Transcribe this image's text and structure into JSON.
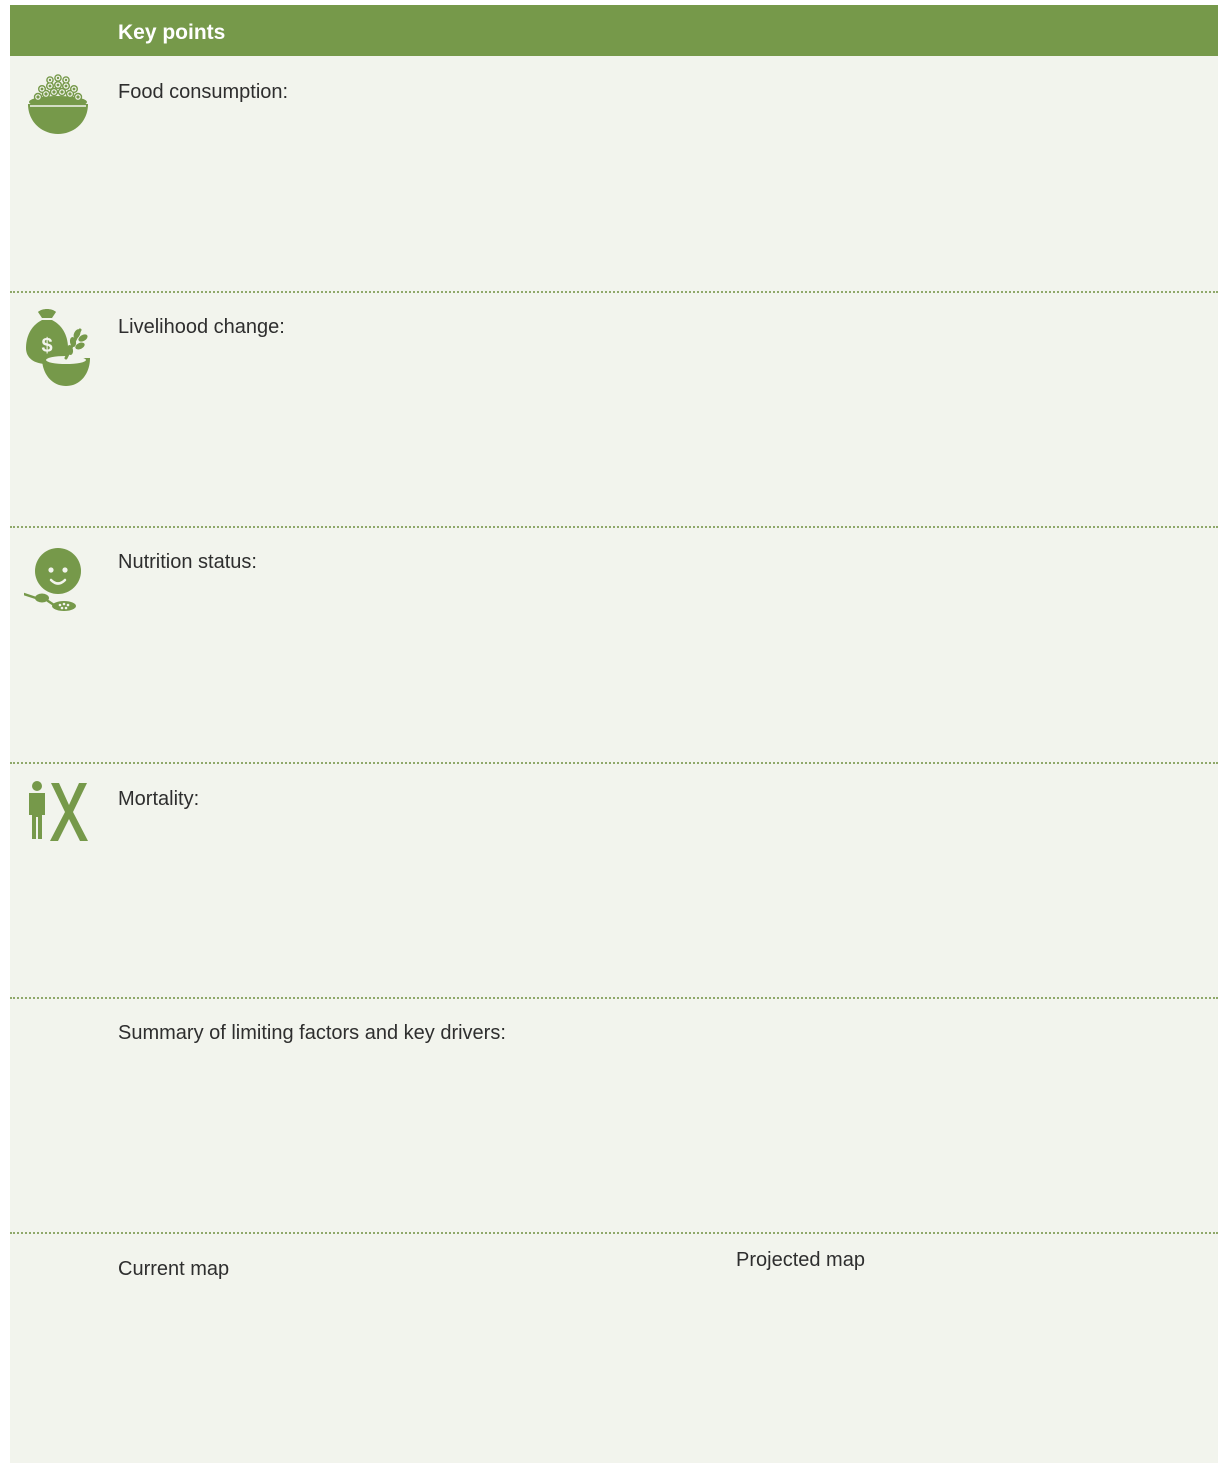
{
  "header": {
    "title": "Key points"
  },
  "sections": [
    {
      "label": "Food consumption:",
      "icon": "food-bowl-icon"
    },
    {
      "label": "Livelihood change:",
      "icon": "money-bag-bowl-icon"
    },
    {
      "label": "Nutrition status:",
      "icon": "child-spoon-icon"
    },
    {
      "label": "Mortality:",
      "icon": "person-cross-icon"
    },
    {
      "label": "Summary of limiting factors and key drivers:",
      "icon": ""
    }
  ],
  "maps": {
    "current_label": "Current map",
    "projected_label": "Projected map"
  },
  "colors": {
    "accent": "#76994a",
    "panel_background": "#f2f4ed",
    "divider": "#8fa86a",
    "text": "#2e2e2e"
  }
}
